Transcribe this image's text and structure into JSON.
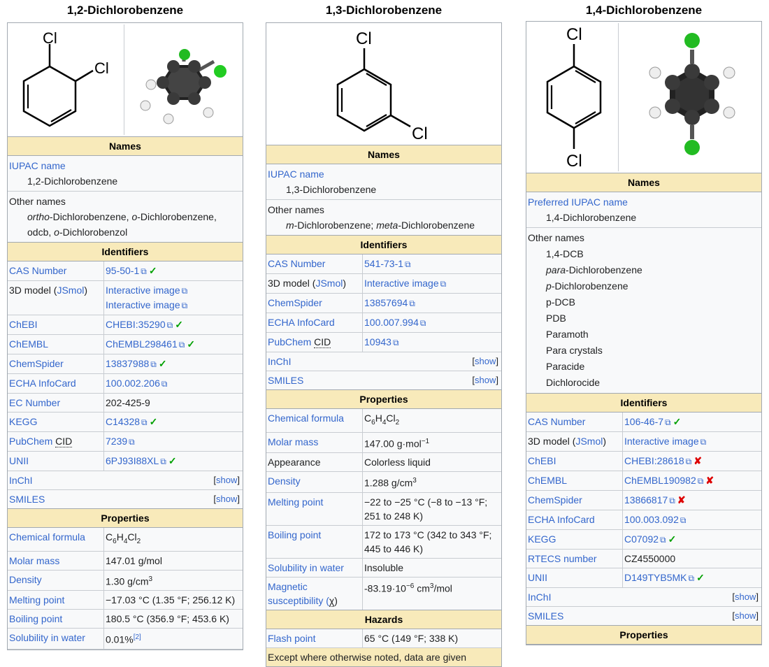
{
  "c1": {
    "title": "1,2-Dichlorobenzene",
    "img_cl1": "Cl",
    "img_cl2": "Cl",
    "names_header": "Names",
    "iupac_label": "IUPAC name",
    "iupac_value": "1,2-Dichlorobenzene",
    "other_label": "Other names",
    "other_a": "ortho",
    "other_b": "-Dichlorobenzene, ",
    "other_c": "o",
    "other_d": "-Dichlorobenzene,",
    "other_e": "odcb, ",
    "other_f": "o",
    "other_g": "-Dichlorobenzol",
    "identifiers_header": "Identifiers",
    "cas_label": "CAS Number",
    "cas_value": "95-50-1",
    "model_label_a": "3D model (",
    "model_label_b": "JSmol",
    "model_label_c": ")",
    "model_v1": "Interactive image",
    "model_v2": "Interactive image",
    "chebi_label": "ChEBI",
    "chebi_value": "CHEBI:35290",
    "chembl_label": "ChEMBL",
    "chembl_value": "ChEMBL298461",
    "cs_label": "ChemSpider",
    "cs_value": "13837988",
    "echa_label": "ECHA InfoCard",
    "echa_value": "100.002.206",
    "ec_label": "EC Number",
    "ec_value": "202-425-9",
    "kegg_label": "KEGG",
    "kegg_value": "C14328",
    "pub_label_a": "PubChem ",
    "pub_label_b": "CID",
    "pub_value": "7239",
    "unii_label": "UNII",
    "unii_value": "6PJ93I88XL",
    "inchi_label": "InChI",
    "smiles_label": "SMILES",
    "show": "show",
    "properties_header": "Properties",
    "formula_label": "Chemical formula",
    "f_c": "C",
    "f_6": "6",
    "f_h": "H",
    "f_4": "4",
    "f_cl": "Cl",
    "f_2": "2",
    "molar_label": "Molar mass",
    "molar_value": "147.01 g/mol",
    "density_label": "Density",
    "density_value": "1.30 g/cm",
    "density_sup": "3",
    "mp_label": "Melting point",
    "mp_value": "−17.03 °C (1.35 °F; 256.12 K)",
    "bp_label": "Boiling point",
    "bp_value": "180.5 °C (356.9 °F; 453.6 K)",
    "sol_label": "Solubility in water",
    "sol_value": "0.01%",
    "sol_ref": "[2]",
    "check": "✓"
  },
  "c2": {
    "title": "1,3-Dichlorobenzene",
    "img_cl1": "Cl",
    "img_cl2": "Cl",
    "names_header": "Names",
    "iupac_label": "IUPAC name",
    "iupac_value": "1,3-Dichlorobenzene",
    "other_label": "Other names",
    "other_a": "m",
    "other_b": "-Dichlorobenzene; ",
    "other_c": "meta",
    "other_d": "-Dichlorobenzene",
    "identifiers_header": "Identifiers",
    "cas_label": "CAS Number",
    "cas_value": "541-73-1",
    "model_label_a": "3D model (",
    "model_label_b": "JSmol",
    "model_label_c": ")",
    "model_v1": "Interactive image",
    "cs_label": "ChemSpider",
    "cs_value": "13857694",
    "echa_label": "ECHA InfoCard",
    "echa_value": "100.007.994",
    "pub_label_a": "PubChem ",
    "pub_label_b": "CID",
    "pub_value": "10943",
    "inchi_label": "InChI",
    "smiles_label": "SMILES",
    "show": "show",
    "properties_header": "Properties",
    "formula_label": "Chemical formula",
    "f_c": "C",
    "f_6": "6",
    "f_h": "H",
    "f_4": "4",
    "f_cl": "Cl",
    "f_2": "2",
    "molar_label": "Molar mass",
    "molar_value": "147.00 g·mol",
    "molar_sup": "−1",
    "appearance_label": "Appearance",
    "appearance_value": "Colorless liquid",
    "density_label": "Density",
    "density_value": "1.288 g/cm",
    "density_sup": "3",
    "mp_label": "Melting point",
    "mp_value": "−22 to −25 °C (−8 to −13 °F; 251 to 248 K)",
    "bp_label": "Boiling point",
    "bp_value": "172 to 173 °C (342 to 343 °F; 445 to 446 K)",
    "sol_label": "Solubility in water",
    "sol_value": "Insoluble",
    "mag_label_a": "Magnetic susceptibility (",
    "mag_label_b": "χ",
    "mag_label_c": ")",
    "mag_value": "-83.19·10",
    "mag_sup": "−6",
    "mag_unit": " cm",
    "mag_sup2": "3",
    "mag_tail": "/mol",
    "hazards_header": "Hazards",
    "flash_label": "Flash point",
    "flash_value": "65 °C (149 °F; 338 K)",
    "footer": "Except where otherwise noted, data are given"
  },
  "c3": {
    "title": "1,4-Dichlorobenzene",
    "img_cl1": "Cl",
    "img_cl2": "Cl",
    "names_header": "Names",
    "iupac_label": "Preferred IUPAC name",
    "iupac_value": "1,4-Dichlorobenzene",
    "other_label": "Other names",
    "o1": "1,4-DCB",
    "o2a": "para",
    "o2b": "-Dichlorobenzene",
    "o3a": "p",
    "o3b": "-Dichlorobenzene",
    "o4": "p-DCB",
    "o5": "PDB",
    "o6": "Paramoth",
    "o7": "Para crystals",
    "o8": "Paracide",
    "o9": "Dichlorocide",
    "identifiers_header": "Identifiers",
    "cas_label": "CAS Number",
    "cas_value": "106-46-7",
    "model_label_a": "3D model (",
    "model_label_b": "JSmol",
    "model_label_c": ")",
    "model_v1": "Interactive image",
    "chebi_label": "ChEBI",
    "chebi_value": "CHEBI:28618",
    "chembl_label": "ChEMBL",
    "chembl_value": "ChEMBL190982",
    "cs_label": "ChemSpider",
    "cs_value": "13866817",
    "echa_label": "ECHA InfoCard",
    "echa_value": "100.003.092",
    "kegg_label": "KEGG",
    "kegg_value": "C07092",
    "rtecs_label": "RTECS number",
    "rtecs_value": "CZ4550000",
    "unii_label": "UNII",
    "unii_value": "D149TYB5MK",
    "inchi_label": "InChI",
    "smiles_label": "SMILES",
    "show": "show",
    "properties_header": "Properties",
    "check": "✓",
    "cross": "✘"
  }
}
